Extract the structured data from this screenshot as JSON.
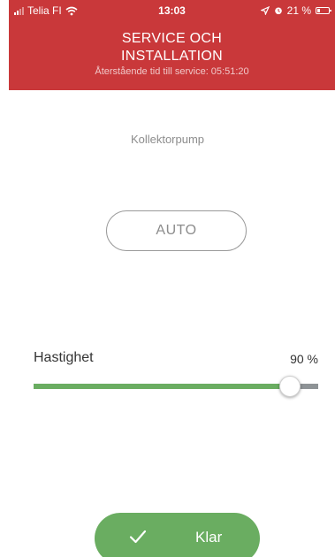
{
  "status_bar": {
    "carrier": "Telia FI",
    "time": "13:03",
    "battery": "21 %",
    "battery_level": 0.21
  },
  "header": {
    "title_line1": "SERVICE OCH",
    "title_line2": "INSTALLATION",
    "subtitle": "Återstående tid till service: 05:51:20",
    "background_color": "#c9383a"
  },
  "pump": {
    "label": "Kollektorpump",
    "mode_button": "AUTO"
  },
  "speed": {
    "label": "Hastighet",
    "value_text": "90 %",
    "value": 90,
    "fill_color": "#6aad61"
  },
  "done_button": {
    "label": "Klar",
    "icon": "check-icon"
  }
}
